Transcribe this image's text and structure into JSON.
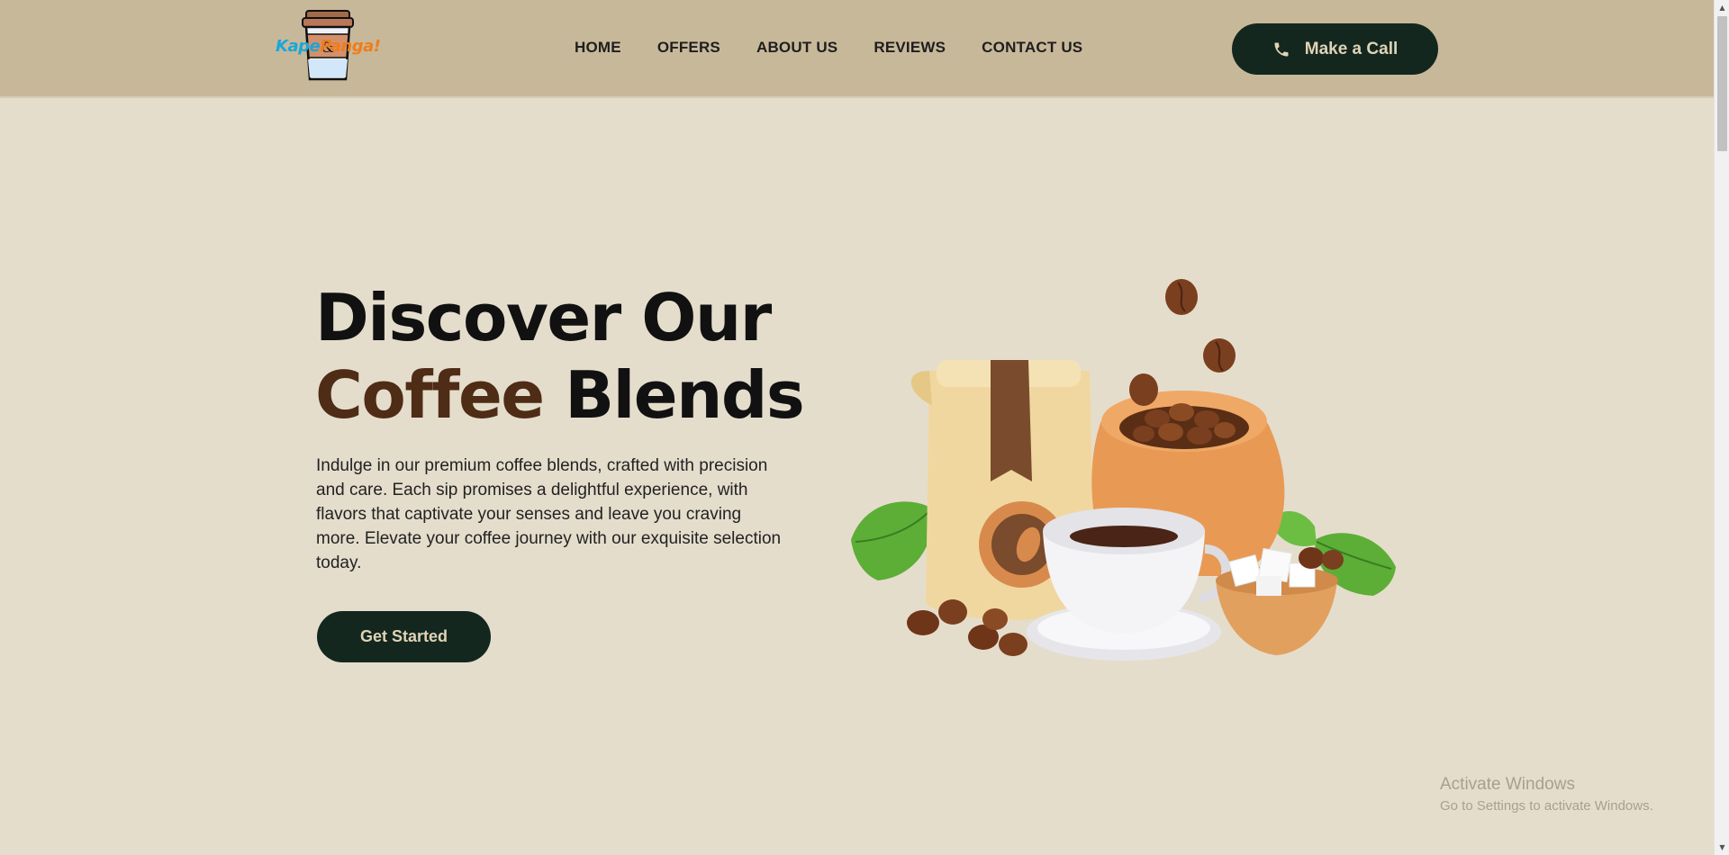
{
  "header": {
    "logo": {
      "text_part1": "Kape",
      "text_part2": "Panga!",
      "colors": {
        "blue": "#1aa7d9",
        "orange": "#ef7d1a"
      }
    },
    "nav": [
      {
        "label": "HOME"
      },
      {
        "label": "OFFERS"
      },
      {
        "label": "ABOUT US"
      },
      {
        "label": "REVIEWS"
      },
      {
        "label": "CONTACT US"
      }
    ],
    "call_button": {
      "label": "Make a Call",
      "icon": "phone-icon"
    }
  },
  "hero": {
    "title_line1": "Discover Our",
    "title_accent": "Coffee",
    "title_line2_rest": "Blends",
    "description": "Indulge in our premium coffee blends, crafted with precision and care. Each sip promises a delightful experience, with flavors that captivate your senses and leave you craving more. Elevate your coffee journey with our exquisite selection today.",
    "cta_label": "Get Started",
    "illustration": "coffee-bag-cup-beans-sugar-illustration"
  },
  "watermark": {
    "title": "Activate Windows",
    "subtitle": "Go to Settings to activate Windows."
  },
  "colors": {
    "header_bg": "#c8b89a",
    "page_bg": "#e5ddcc",
    "button_bg": "#13271f",
    "button_text": "#e0d3b6",
    "accent_brown": "#4e2c16"
  }
}
